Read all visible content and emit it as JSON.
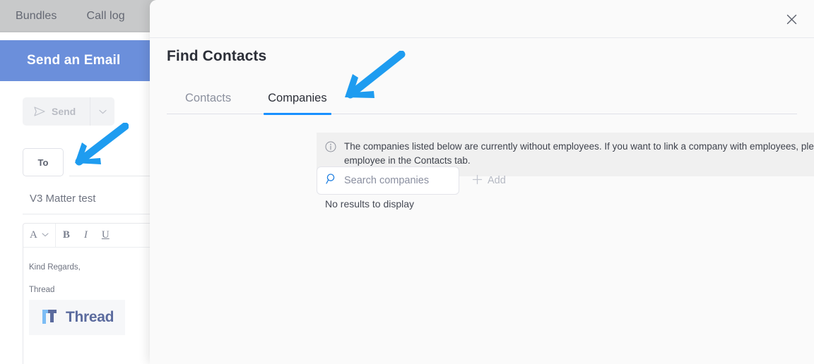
{
  "colors": {
    "accent_blue": "#1890ff",
    "header_blue": "#6b8fdb",
    "annotation_arrow": "#1e9cf0",
    "banner_bg": "#f0f0f0",
    "modal_bg": "#fafafa"
  },
  "background_app": {
    "topbar": {
      "tabs": [
        {
          "label": "Bundles"
        },
        {
          "label": "Call log"
        }
      ]
    },
    "email_panel": {
      "title": "Send an Email",
      "send_button": {
        "label": "Send",
        "icon": "send-paper-plane-icon",
        "caret": "chevron-down-icon",
        "disabled": true
      },
      "to_button": {
        "label": "To"
      },
      "subject_value": "V3 Matter test",
      "toolbar": [
        {
          "name": "font-color",
          "label": "A",
          "caret": "⌄"
        },
        {
          "name": "bold",
          "label": "B"
        },
        {
          "name": "italic",
          "label": "I"
        },
        {
          "name": "underline",
          "label": "U"
        }
      ],
      "signature": {
        "line1": "Kind Regards,",
        "line2": "Thread",
        "logo_text": "Thread"
      }
    }
  },
  "modal": {
    "close_label": "✕",
    "heading": "Find Contacts",
    "tabs": [
      {
        "label": "Contacts",
        "active": false
      },
      {
        "label": "Companies",
        "active": true
      }
    ],
    "info_banner": {
      "icon": "info-circle-icon",
      "text": "The companies listed below are currently without employees. If you want to link a company with employees, please select the company's employee in the Contacts tab."
    },
    "search": {
      "placeholder": "Search companies",
      "value": "",
      "icon": "search-icon"
    },
    "add_button": {
      "label": "Add",
      "icon": "plus-icon"
    },
    "empty_state": "No results to display"
  },
  "annotations": [
    {
      "name": "arrow-pointing-to-to-button",
      "direction": "down-left"
    },
    {
      "name": "arrow-pointing-to-companies-tab",
      "direction": "down-left"
    }
  ]
}
